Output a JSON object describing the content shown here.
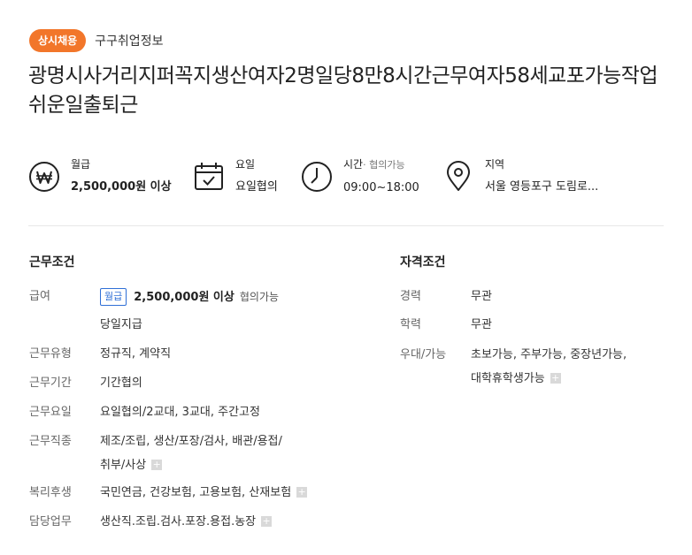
{
  "header": {
    "badge": "상시채용",
    "company": "구구취업정보",
    "title": "광명시사거리지퍼꼭지생산여자2명일당8만8시간근무여자58세교포가능작업쉬운일출퇴근"
  },
  "summary": {
    "salary": {
      "icon": "won-icon",
      "label": "월급",
      "value": "2,500,000원 이상"
    },
    "days": {
      "icon": "calendar-icon",
      "label": "요일",
      "value": "요일협의"
    },
    "time": {
      "icon": "clock-icon",
      "label": "시간",
      "sub": "· 협의가능",
      "value": "09:00~18:00"
    },
    "region": {
      "icon": "location-pin-icon",
      "label": "지역",
      "value": "서울 영등포구 도림로..."
    }
  },
  "work": {
    "title": "근무조건",
    "salary_key": "급여",
    "salary_tag": "월급",
    "salary_amount": "2,500,000원 이상",
    "salary_nego": "협의가능",
    "salary_extra": "당일지급",
    "type_key": "근무유형",
    "type_val": "정규직, 계약직",
    "period_key": "근무기간",
    "period_val": "기간협의",
    "days_key": "근무요일",
    "days_val": "요일협의/2교대, 3교대, 주간고정",
    "job_key": "근무직종",
    "job_val_1": "제조/조립, 생산/포장/검사, 배관/용접/",
    "job_val_2": "취부/사상",
    "welfare_key": "복리후생",
    "welfare_val": "국민연금, 건강보험, 고용보험, 산재보험",
    "duty_key": "담당업무",
    "duty_val": "생산직.조립.검사.포장.용접.농장"
  },
  "qual": {
    "title": "자격조건",
    "career_key": "경력",
    "career_val": "무관",
    "edu_key": "학력",
    "edu_val": "무관",
    "pref_key": "우대/가능",
    "pref_val_1": "초보가능, 주부가능, 중장년가능,",
    "pref_val_2": "대학휴학생가능"
  },
  "colors": {
    "accent": "#f2762a",
    "tag_blue": "#2f6fd6"
  }
}
